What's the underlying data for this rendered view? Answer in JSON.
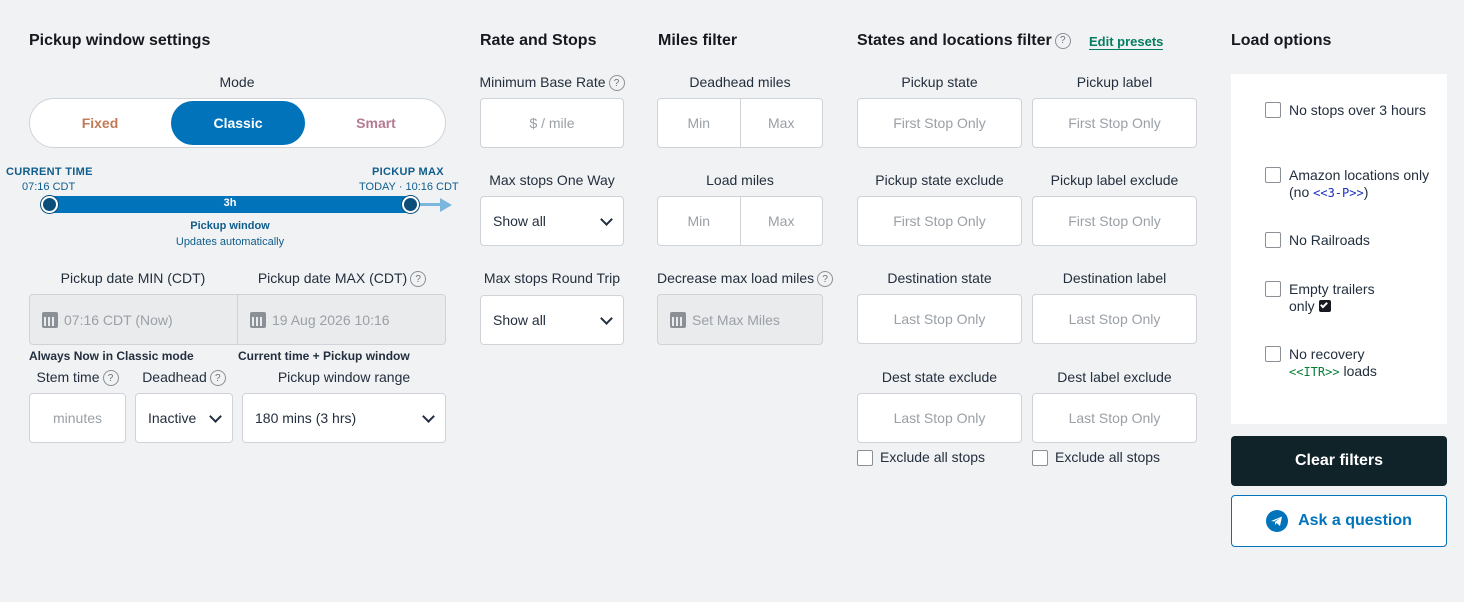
{
  "pickup_window": {
    "title": "Pickup window settings",
    "mode_label": "Mode",
    "modes": [
      "Fixed",
      "Classic",
      "Smart"
    ],
    "selected_mode": "Classic",
    "timeline": {
      "current_label": "CURRENT TIME",
      "current_value": "07:16 CDT",
      "max_label": "PICKUP MAX",
      "max_value": "TODAY · 10:16 CDT",
      "duration": "3h",
      "caption": "Pickup window",
      "subcaption": "Updates automatically"
    },
    "date_min_label": "Pickup date MIN (CDT)",
    "date_min_value": "07:16 CDT (Now)",
    "date_min_note": "Always Now in Classic mode",
    "date_max_label": "Pickup date MAX (CDT)",
    "date_max_value": "19 Aug 2026 10:16",
    "date_max_note": "Current time + Pickup window",
    "stem_label": "Stem time",
    "stem_placeholder": "minutes",
    "deadhead_label": "Deadhead",
    "deadhead_value": "Inactive",
    "range_label": "Pickup window range",
    "range_value": "180 mins (3 hrs)"
  },
  "rate": {
    "title": "Rate and Stops",
    "min_rate_label": "Minimum Base Rate",
    "min_rate_placeholder": "$ / mile",
    "oneway_label": "Max stops One Way",
    "oneway_value": "Show all",
    "roundtrip_label": "Max stops Round Trip",
    "roundtrip_value": "Show all"
  },
  "miles": {
    "title": "Miles filter",
    "deadhead_label": "Deadhead miles",
    "load_label": "Load miles",
    "min_placeholder": "Min",
    "max_placeholder": "Max",
    "decrease_label": "Decrease max load miles",
    "decrease_placeholder": "Set Max Miles"
  },
  "states": {
    "title": "States and locations filter",
    "edit_link": "Edit presets",
    "pickup_state": "Pickup state",
    "pickup_label": "Pickup label",
    "pickup_state_exclude": "Pickup state exclude",
    "pickup_label_exclude": "Pickup label exclude",
    "dest_state": "Destination state",
    "dest_label": "Destination label",
    "dest_state_exclude": "Dest state exclude",
    "dest_label_exclude": "Dest label exclude",
    "first_stop": "First Stop Only",
    "last_stop": "Last Stop Only",
    "exclude_all": "Exclude all stops"
  },
  "load_options": {
    "title": "Load options",
    "opt1": "No stops over 3 hours",
    "opt2_a": "Amazon locations only (no ",
    "opt2_tag": "<<3-P>>",
    "opt2_b": ")",
    "opt3": "No Railroads",
    "opt4": "Empty trailers only",
    "opt5_a": "No recovery",
    "opt5_tag": "<<ITR>>",
    "opt5_b": " loads",
    "clear": "Clear filters",
    "ask": "Ask a question"
  },
  "colors": {
    "accent": "#0073bb",
    "fixed": "#c07a55",
    "smart": "#b57a93",
    "dark": "#0f2329"
  }
}
